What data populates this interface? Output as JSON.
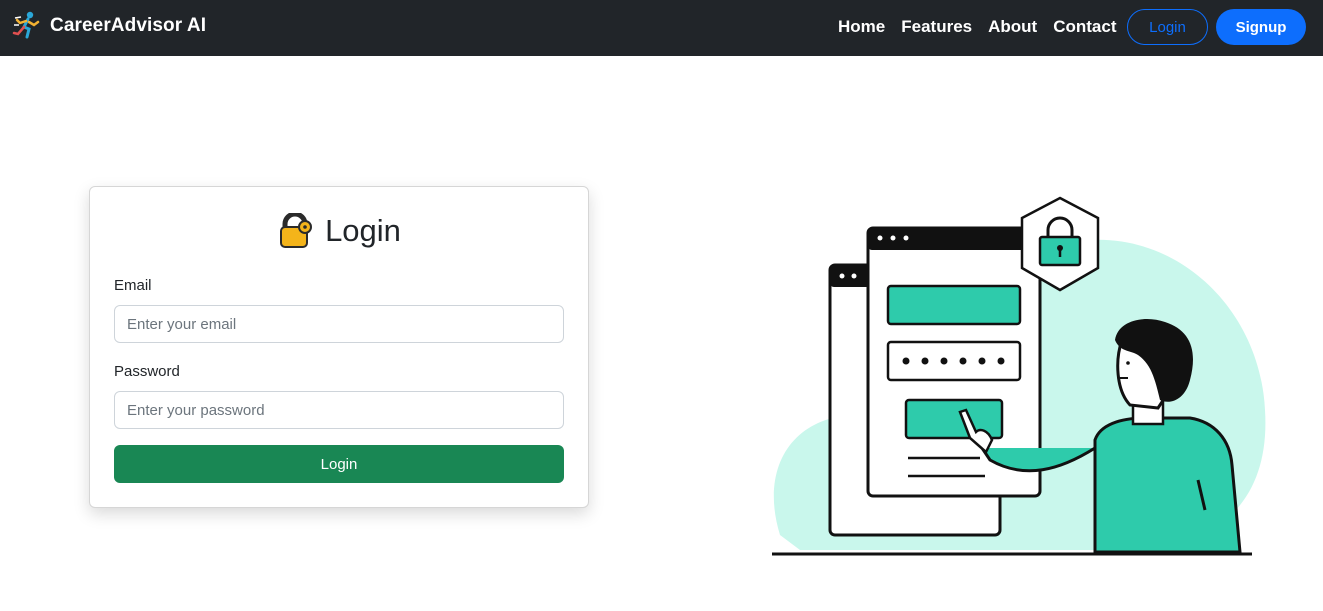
{
  "navbar": {
    "brand": "CareerAdvisor AI",
    "links": [
      "Home",
      "Features",
      "About",
      "Contact"
    ],
    "login_label": "Login",
    "signup_label": "Signup"
  },
  "login_card": {
    "title": "Login",
    "email_label": "Email",
    "email_placeholder": "Enter your email",
    "password_label": "Password",
    "password_placeholder": "Enter your password",
    "submit_label": "Login"
  },
  "icons": {
    "brand": "runner-icon",
    "title": "lock-icon"
  },
  "colors": {
    "navbar_bg": "#212529",
    "primary": "#0d6efd",
    "success": "#198754",
    "illustration_teal": "#2ecbab",
    "illustration_bg": "#c9f7ec"
  }
}
